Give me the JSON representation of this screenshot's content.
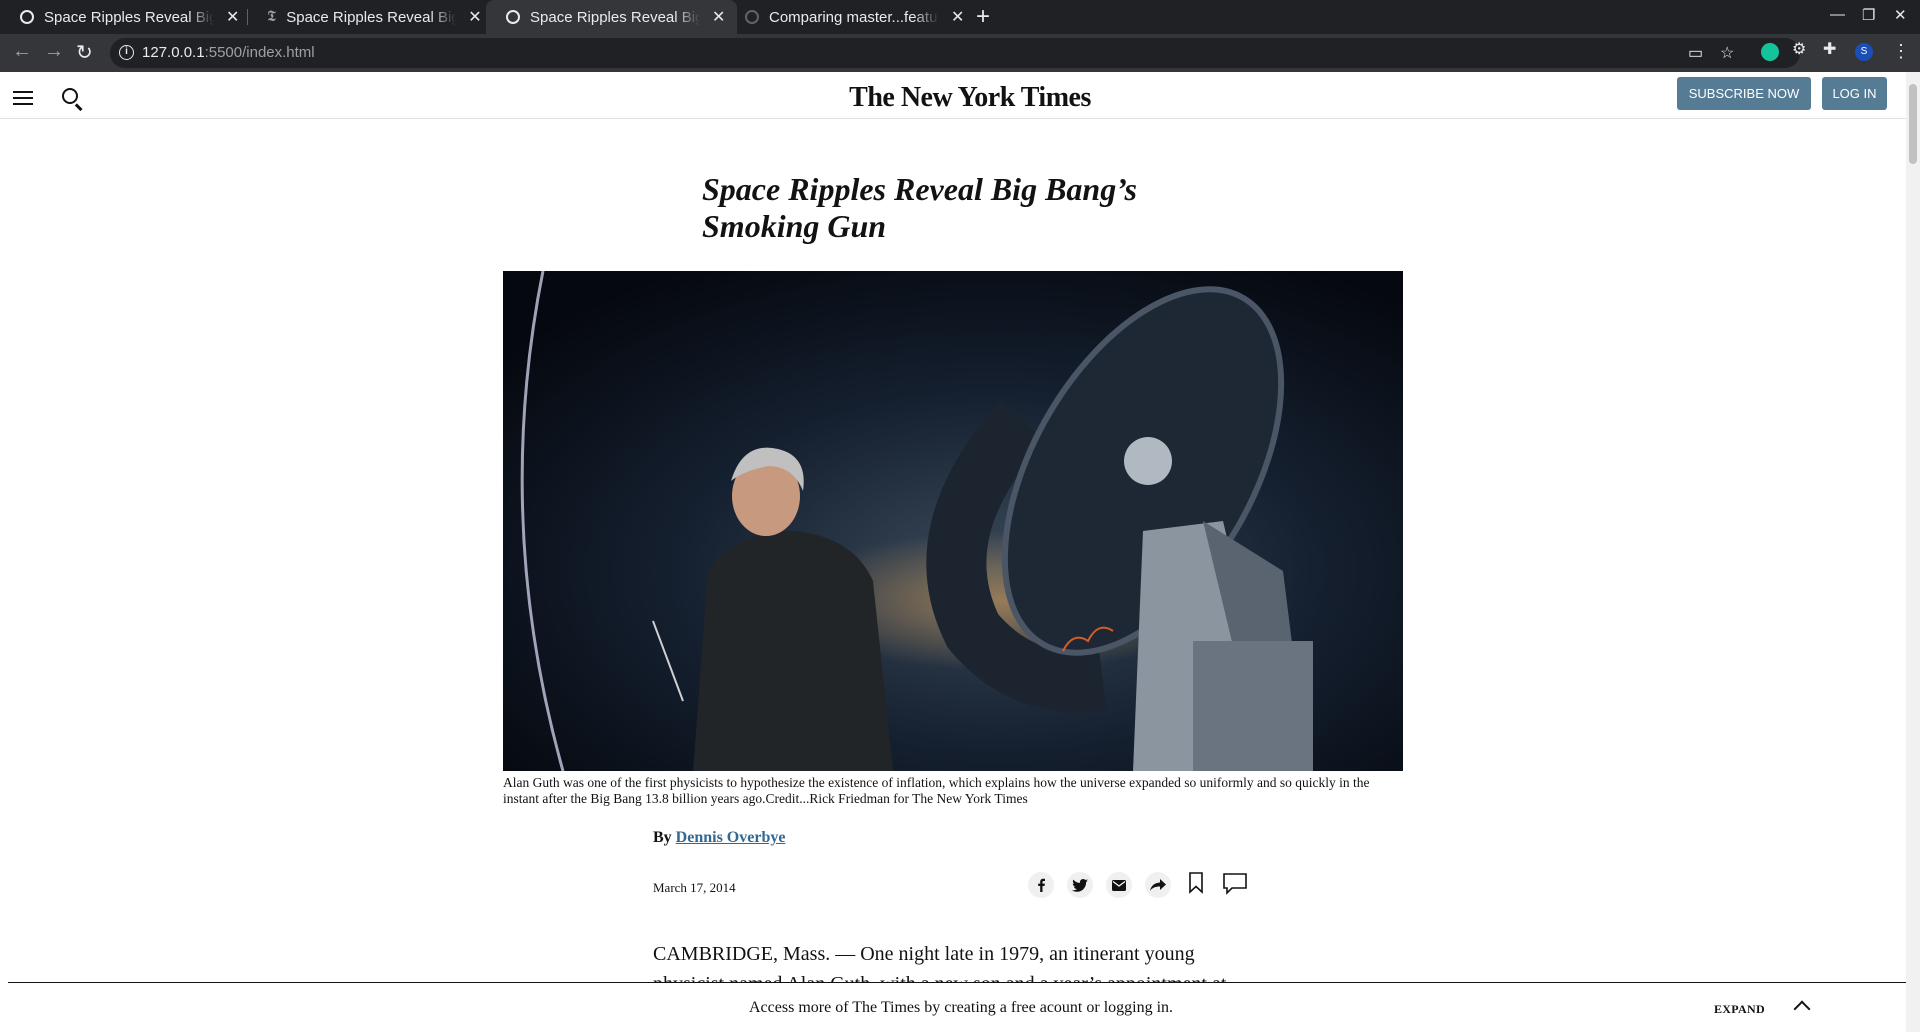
{
  "browser": {
    "tabs": [
      {
        "title": "Space Ripples Reveal Big Bang’s Smoking Gun",
        "active": false
      },
      {
        "title": "Space Ripples Reveal Big Bang’s Smoking Gun",
        "active": false
      },
      {
        "title": "Space Ripples Reveal Big Bang’s Smoking Gun",
        "active": true
      },
      {
        "title": "Comparing master...feature",
        "active": false
      }
    ],
    "url_host": "127.0.0.1",
    "url_rest": ":5500/index.html",
    "profile_initial": "S"
  },
  "masthead": {
    "logo": "The New York Times",
    "subscribe_label": "SUBSCRIBE NOW",
    "login_label": "LOG IN"
  },
  "article": {
    "headline_line1": "Space Ripples Reveal Big Bang’s",
    "headline_line2": "Smoking Gun",
    "caption": "Alan Guth was one of the first physicists to hypothesize the existence of inflation, which explains how the universe expanded so uniformly and so quickly in the instant after the Big Bang 13.8 billion years ago.Credit...Rick Friedman for The New York Times",
    "byline_prefix": "By",
    "author": "Dennis Overbye",
    "date": "March 17, 2014",
    "body_line1": "CAMBRIDGE, Mass. — One night late in 1979, an itinerant young",
    "body_line2": "physicist named Alan Guth, with a new son and a year’s appointment at"
  },
  "gateway": {
    "message": "Access more of The Times by creating a free acount or logging in.",
    "expand_label": "EXPAND"
  },
  "colors": {
    "button_blue": "#567b95",
    "link_blue": "#326891",
    "chrome_dark": "#202124"
  }
}
